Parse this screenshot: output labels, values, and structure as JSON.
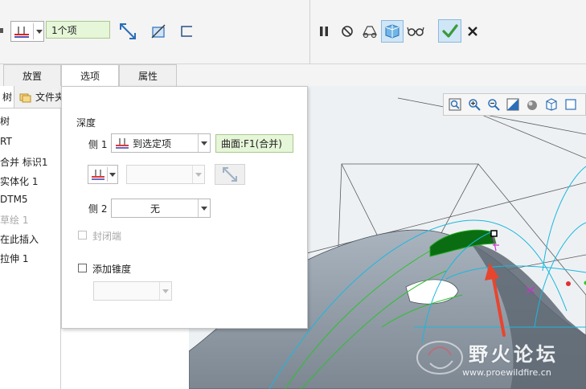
{
  "ribbon": {
    "reference_value": "1个项",
    "icons": [
      "depth-to-selected-icon",
      "flip-direction-icon",
      "remove-material-icon",
      "thicken-icon"
    ],
    "right_icons": [
      "pause-icon",
      "no-preview-icon",
      "verify-preview-icon",
      "geometry-preview-icon",
      "glasses-preview-icon",
      "confirm-check-icon",
      "cancel-x-icon"
    ],
    "accent_green": "#3a9a3a",
    "cancel_color": "#222222"
  },
  "tabs": [
    {
      "label": "放置"
    },
    {
      "label": "选项"
    },
    {
      "label": "属性"
    }
  ],
  "tree": {
    "tab_tree_label": "树",
    "tab_file_label": "文件夹",
    "header": "树",
    "items": [
      {
        "label": "RT"
      },
      {
        "label": "合并 标识1"
      },
      {
        "label": "实体化 1"
      },
      {
        "label": "DTM5"
      },
      {
        "label": "草绘 1"
      },
      {
        "label": "在此插入"
      },
      {
        "label": "拉伸 1"
      }
    ]
  },
  "options_panel": {
    "depth_label": "深度",
    "side1_label": "侧 1",
    "side1_option": "到选定项",
    "side1_reference": "曲面:F1(合并)",
    "side2_label": "侧 2",
    "side2_option": "无",
    "capped_ends_label": "封闭端",
    "add_taper_label": "添加锥度"
  },
  "viewport": {
    "view_icons": [
      "refit-icon",
      "zoom-in-icon",
      "zoom-out-icon",
      "repaint-icon",
      "display-style-icon",
      "saved-views-icon",
      "view-manager-icon"
    ],
    "watermark_title": "野火论坛",
    "watermark_url": "www.proewildfire.cn",
    "model_color": "#8e99a5",
    "highlight_color": "#0a6d12",
    "curve_color": "#19b8dd",
    "arrow_color": "#e8452f"
  }
}
